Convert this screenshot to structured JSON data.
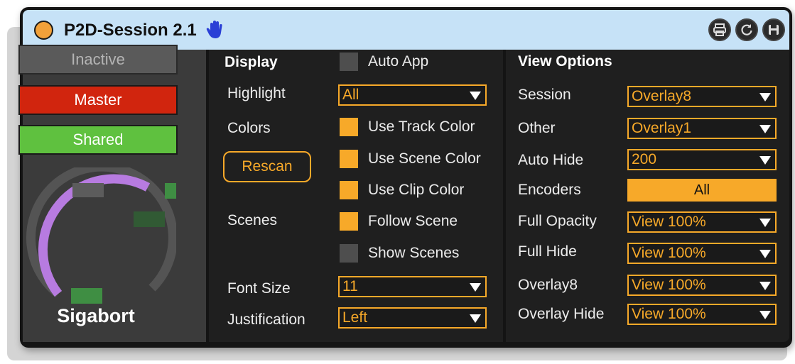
{
  "title": "P2D-Session 2.1",
  "left": {
    "buttons": {
      "inactive": "Inactive",
      "master": "Master",
      "shared": "Shared"
    },
    "knob_label": "Sigabort"
  },
  "display": {
    "header": "Display",
    "auto_app": "Auto App",
    "highlight_label": "Highlight",
    "highlight_value": "All",
    "colors_label": "Colors",
    "rescan": "Rescan",
    "use_track_color": "Use Track Color",
    "use_scene_color": "Use Scene Color",
    "use_clip_color": "Use Clip Color",
    "scenes_label": "Scenes",
    "follow_scene": "Follow Scene",
    "show_scenes": "Show Scenes",
    "font_size_label": "Font Size",
    "font_size_value": "11",
    "justification_label": "Justification",
    "justification_value": "Left"
  },
  "view_options": {
    "header": "View Options",
    "session_label": "Session",
    "session_value": "Overlay8",
    "other_label": "Other",
    "other_value": "Overlay1",
    "auto_hide_label": "Auto Hide",
    "auto_hide_value": "200",
    "encoders_label": "Encoders",
    "encoders_value": "All",
    "full_opacity_label": "Full Opacity",
    "full_opacity_value": "View 100%",
    "full_hide_label": "Full Hide",
    "full_hide_value": "View 100%",
    "overlay8_label": "Overlay8",
    "overlay8_value": "View 100%",
    "overlay_hide_label": "Overlay Hide",
    "overlay_hide_value": "View 100%"
  },
  "icons": [
    "hand-icon",
    "print-icon",
    "refresh-icon",
    "save-icon"
  ],
  "colors": {
    "accent": "#f7a929",
    "master": "#d1250e",
    "shared": "#5fc13f",
    "titlebar": "#c6e2f7",
    "knob_arc": "#b77be0"
  }
}
